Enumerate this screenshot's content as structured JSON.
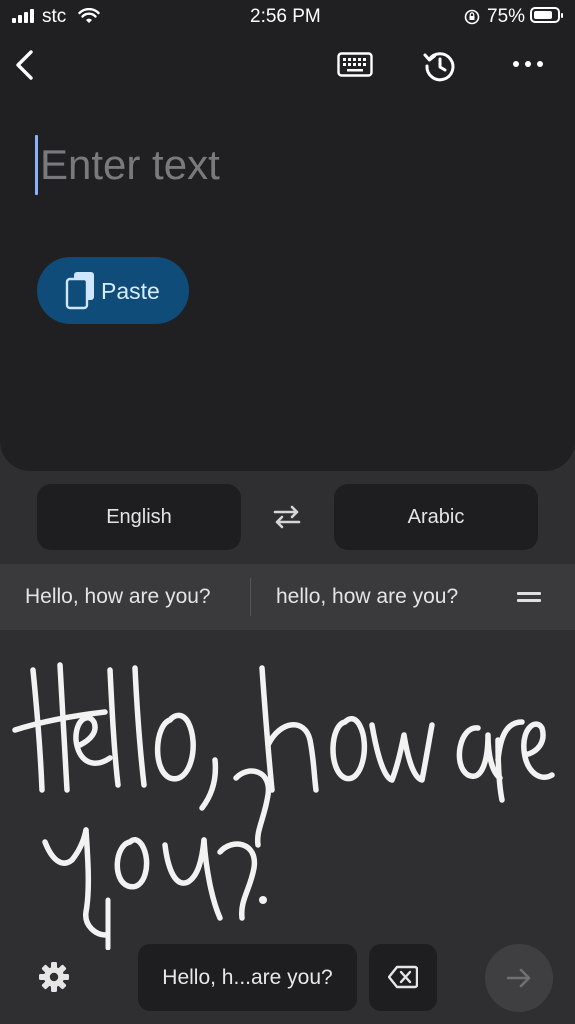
{
  "status_bar": {
    "carrier": "stc",
    "time": "2:56 PM",
    "battery": "75%"
  },
  "toolbar": {
    "back_icon": "chevron-left-icon",
    "keyboard_icon": "keyboard-icon",
    "history_icon": "history-icon",
    "more_icon": "more-horizontal-icon"
  },
  "input": {
    "placeholder": "Enter text",
    "paste_label": "Paste"
  },
  "languages": {
    "source": "English",
    "target": "Arabic",
    "swap_icon": "swap-icon"
  },
  "suggestions": {
    "items": [
      "Hello, how are you?",
      "hello, how are you?"
    ],
    "menu_icon": "menu-icon"
  },
  "handwriting": {
    "recognized": "Hello, h...are you?"
  },
  "colors": {
    "accent": "#8ab4f8",
    "paste_bg": "#0f4c7a"
  }
}
